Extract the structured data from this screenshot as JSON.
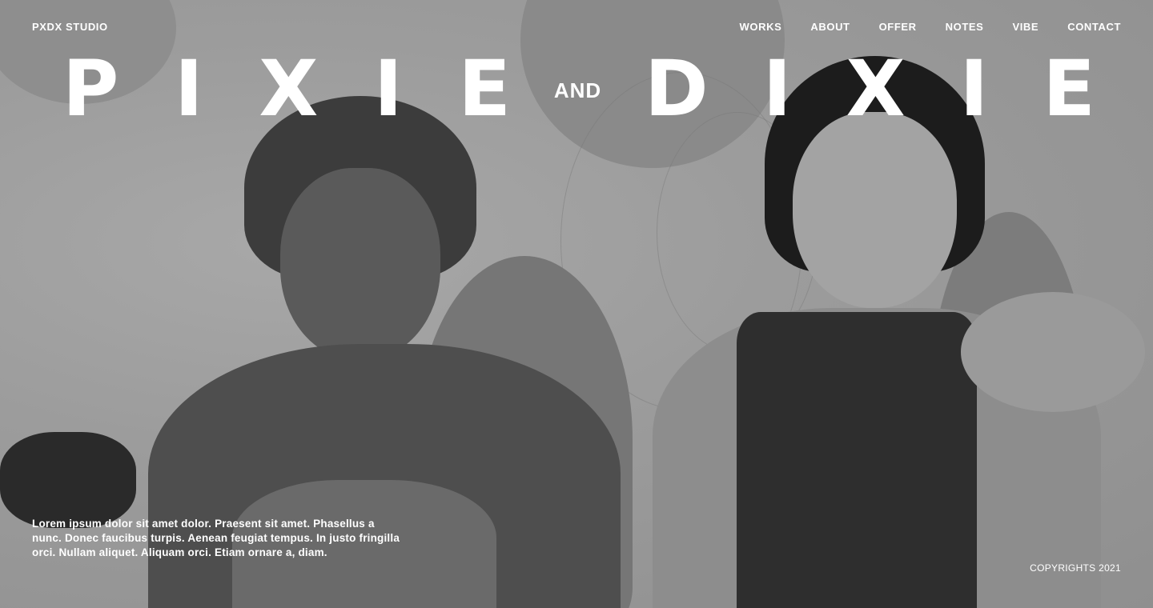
{
  "brand": "PXDX STUDIO",
  "nav": {
    "items": [
      {
        "label": "WORKS"
      },
      {
        "label": "ABOUT"
      },
      {
        "label": "OFFER"
      },
      {
        "label": "NOTES"
      },
      {
        "label": "VIBE"
      },
      {
        "label": "CONTACT"
      }
    ]
  },
  "title": {
    "word1": [
      "P",
      "I",
      "X",
      "I",
      "E"
    ],
    "connector": "AND",
    "word2": [
      "D",
      "I",
      "X",
      "I",
      "E"
    ]
  },
  "blurb": "Lorem ipsum dolor sit amet dolor. Praesent sit amet. Phasellus a nunc. Donec faucibus turpis. Aenean feugiat tempus. In justo fringilla orci. Nullam aliquet. Aliquam orci. Etiam ornare a, diam.",
  "copyright": "COPYRIGHTS 2021",
  "colors": {
    "text": "#ffffff",
    "background": "#9a9a9a",
    "shape": "#7a7a7a"
  }
}
